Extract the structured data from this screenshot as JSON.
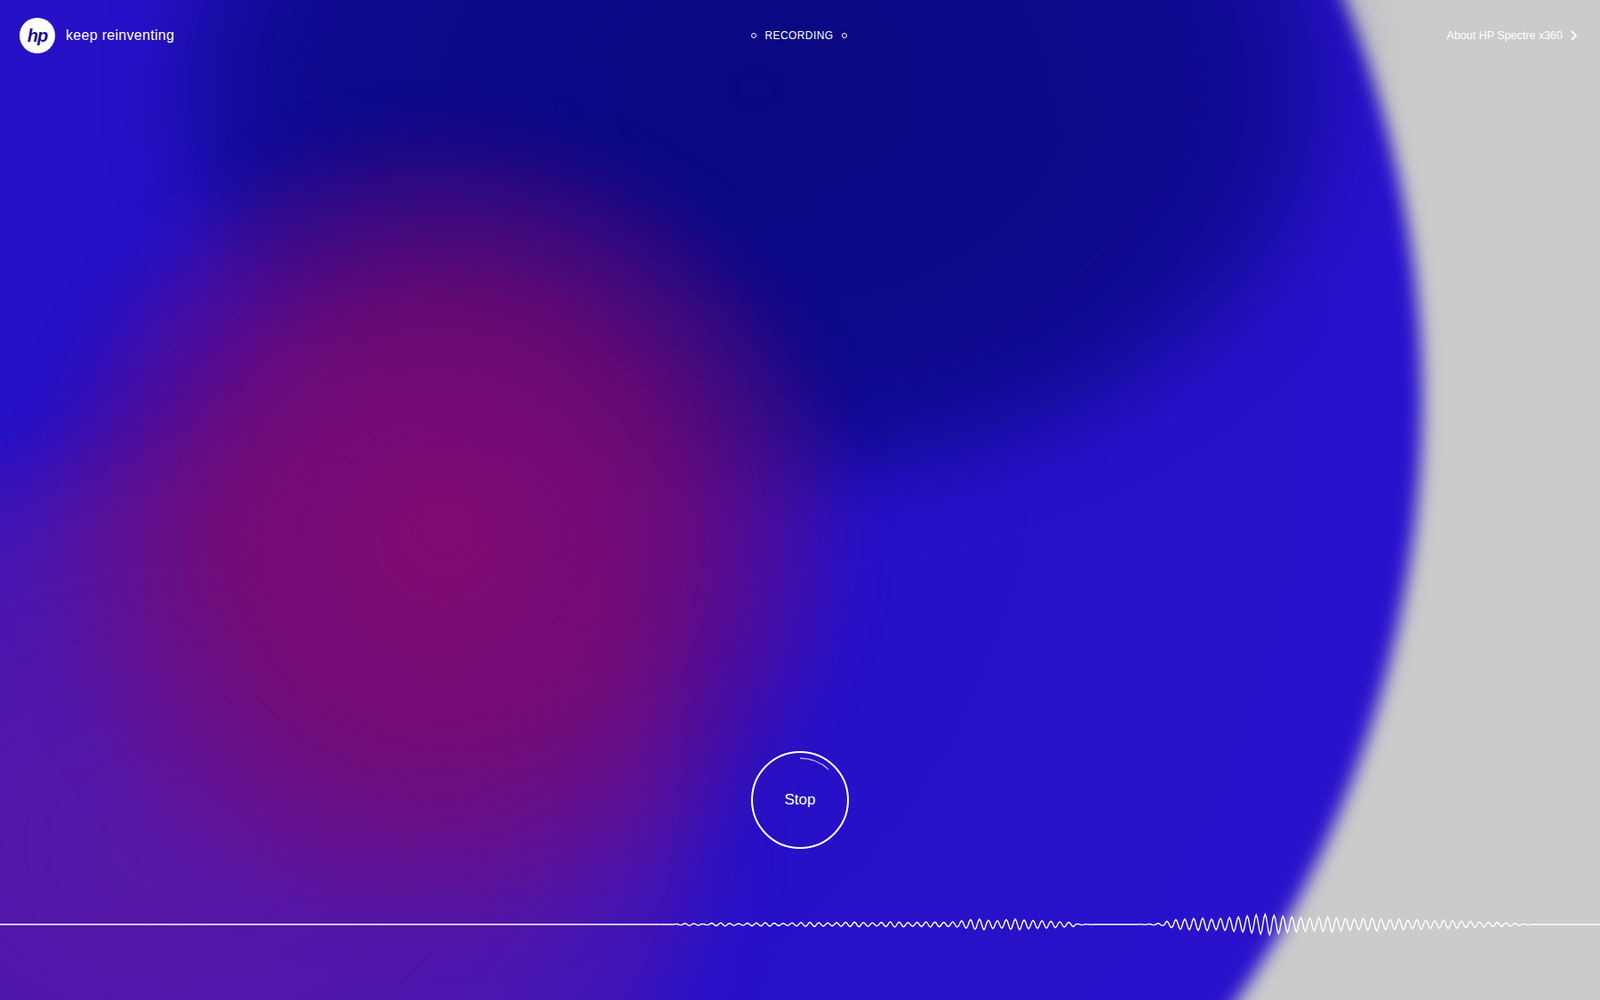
{
  "logo": {
    "text": "hp",
    "tagline": "keep reinventing"
  },
  "status": {
    "label": "RECORDING",
    "recording": true
  },
  "link": {
    "label": "About HP Spectre x360"
  },
  "record_button": {
    "label": "Stop",
    "level": 0.12
  },
  "waveform": {
    "amplitudes": [
      0.05,
      0.1,
      0.08,
      0.05,
      0.12,
      0.15,
      0.1,
      0.08,
      0.12,
      0.14,
      0.16,
      0.12,
      0.1,
      0.15,
      0.18,
      0.2,
      0.16,
      0.14,
      0.18,
      0.2,
      0.22,
      0.18,
      0.15,
      0.2,
      0.25,
      0.22,
      0.18,
      0.2,
      0.24,
      0.22,
      0.2,
      0.25,
      0.35,
      0.45,
      0.5,
      0.4,
      0.35,
      0.45,
      0.5,
      0.42,
      0.38,
      0.35,
      0.3,
      0.25,
      0.2,
      0.05,
      0.02,
      0,
      0,
      0,
      0,
      0,
      0.02,
      0.05,
      0.1,
      0.3,
      0.45,
      0.5,
      0.55,
      0.6,
      0.5,
      0.55,
      0.65,
      0.7,
      0.8,
      0.9,
      0.95,
      0.85,
      0.75,
      0.7,
      0.65,
      0.6,
      0.65,
      0.7,
      0.6,
      0.55,
      0.5,
      0.55,
      0.6,
      0.5,
      0.45,
      0.5,
      0.4,
      0.45,
      0.4,
      0.35,
      0.4,
      0.35,
      0.3,
      0.3,
      0.25,
      0.2,
      0.2,
      0.15,
      0.1,
      0.05
    ]
  }
}
